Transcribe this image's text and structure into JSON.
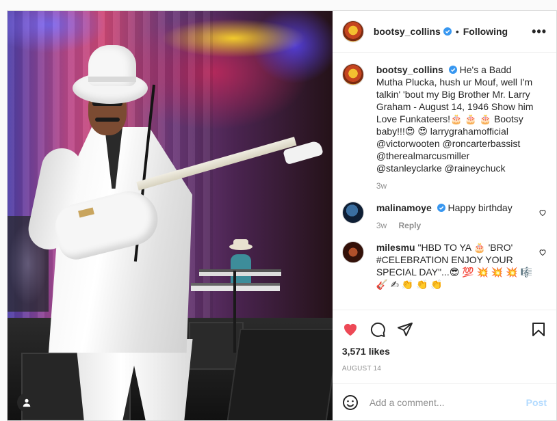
{
  "post": {
    "author": "bootsy_collins",
    "separator": "•",
    "follow_status": "Following",
    "more_label": "•••",
    "caption": "He's a Badd Mutha Plucka, hush ur Mouf, well I'm talkin' 'bout my Big Brother Mr. Larry Graham - August 14, 1946 Show him Love Funkateers!🎂 🎂 🎂 Bootsy baby!!!😍 😍 larrygrahamofficial @victorwooten @roncarterbassist @therealmarcusmiller @stanleyclarke @raineychuck",
    "caption_time": "3w",
    "likes": "3,571 likes",
    "date": "AUGUST 14"
  },
  "comments": [
    {
      "user": "malinamoye",
      "text": "Happy birthday",
      "time": "3w",
      "reply": "Reply"
    },
    {
      "user": "milesmu",
      "text": "\"HBD TO YA 🎂 'BRO' #CELEBRATION ENJOY YOUR SPECIAL DAY\"...😎 💯 💥 💥 💥 🎼 🎸 ✍ 👏 👏 👏"
    }
  ],
  "add_comment": {
    "placeholder": "Add a comment...",
    "post_label": "Post"
  },
  "icons": {
    "verified": "verified-badge-icon",
    "like": "heart-filled-icon",
    "comment": "comment-icon",
    "share": "paper-plane-icon",
    "save": "bookmark-icon",
    "emoji": "smiley-icon",
    "user_tag": "user-tag-icon"
  },
  "colors": {
    "like_red": "#ed4956",
    "verified_blue": "#3897f0",
    "post_disabled": "#b3dbff"
  }
}
